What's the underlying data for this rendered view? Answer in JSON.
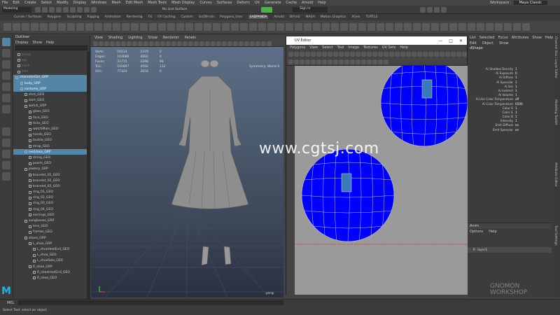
{
  "menubar": [
    "File",
    "Edit",
    "Create",
    "Select",
    "Modify",
    "Display",
    "Windows",
    "Mesh",
    "Edit Mesh",
    "Mesh Tools",
    "Mesh Display",
    "Curves",
    "Surfaces",
    "Deform",
    "UV",
    "Generate",
    "Cache",
    "Arnold",
    "Help"
  ],
  "workspace": {
    "label": "Workspace :",
    "value": "Maya Classic"
  },
  "statusline": {
    "mode": "Modeling",
    "live_surface": "No Live Surface",
    "sign_in": "Sign In"
  },
  "shelf_tabs": [
    "Curves / Surfaces",
    "Polygons",
    "Sculpting",
    "Rigging",
    "Animation",
    "Rendering",
    "FX",
    "FX Caching",
    "Custom",
    "GoZBrush",
    "Polygons_User",
    "SADPANDA",
    "Arnold",
    "Bifrost",
    "MASH",
    "Motion Graphics",
    "XGen",
    "TURTLE"
  ],
  "shelf_active": "SADPANDA",
  "outliner": {
    "title": "Outliner",
    "menu": [
      "Display",
      "Show",
      "Help"
    ],
    "items": [
      {
        "label": "persp",
        "indent": 6,
        "dim": true
      },
      {
        "label": "top",
        "indent": 6,
        "dim": true
      },
      {
        "label": "front",
        "indent": 6,
        "dim": true
      },
      {
        "label": "side",
        "indent": 6,
        "dim": true
      },
      {
        "label": "characterGirl_GRP",
        "indent": 3,
        "sel": true
      },
      {
        "label": "body_GRP",
        "indent": 10,
        "sel": true
      },
      {
        "label": "costume_GRP",
        "indent": 10,
        "sel": true
      },
      {
        "label": "shirt_GEO",
        "indent": 16
      },
      {
        "label": "skirt_GEO",
        "indent": 16
      },
      {
        "label": "watch_GRP",
        "indent": 16
      },
      {
        "label": "glass_GEO",
        "indent": 22
      },
      {
        "label": "face_GEO",
        "indent": 22
      },
      {
        "label": "ticks_GEO",
        "indent": 22
      },
      {
        "label": "watchMain_GEO",
        "indent": 22
      },
      {
        "label": "hands_GEO",
        "indent": 22
      },
      {
        "label": "buckle_GEO",
        "indent": 22
      },
      {
        "label": "strap_GEO",
        "indent": 22
      },
      {
        "label": "necklace_GRP",
        "indent": 16,
        "sel": true
      },
      {
        "label": "string_GEO",
        "indent": 22
      },
      {
        "label": "pearls_GEO",
        "indent": 22
      },
      {
        "label": "jewlery_GRP",
        "indent": 16
      },
      {
        "label": "bracelet_01_GEO",
        "indent": 22
      },
      {
        "label": "bracelet_02_GEO",
        "indent": 22
      },
      {
        "label": "bracelet_03_GEO",
        "indent": 22
      },
      {
        "label": "ring_01_GEO",
        "indent": 22
      },
      {
        "label": "ring_02_GEO",
        "indent": 22
      },
      {
        "label": "ring_03_GEO",
        "indent": 22
      },
      {
        "label": "ring_04_GEO",
        "indent": 22
      },
      {
        "label": "earrings_GEO",
        "indent": 22
      },
      {
        "label": "sunglasses_GRP",
        "indent": 16
      },
      {
        "label": "lens_GEO",
        "indent": 22
      },
      {
        "label": "frames_GEO",
        "indent": 22
      },
      {
        "label": "shoes_GRP",
        "indent": 16
      },
      {
        "label": "L_shoe_GRP",
        "indent": 22
      },
      {
        "label": "L_shoeHeelEnd_GEO",
        "indent": 28
      },
      {
        "label": "L_shoe_GEO",
        "indent": 28
      },
      {
        "label": "L_shoeSole_GEO",
        "indent": 28
      },
      {
        "label": "R_shoe_GRP",
        "indent": 22
      },
      {
        "label": "R_shoeHeelEnd_GEO",
        "indent": 28
      },
      {
        "label": "R_shoe_GEO",
        "indent": 28
      }
    ]
  },
  "viewport": {
    "menu": [
      "View",
      "Shading",
      "Lighting",
      "Show",
      "Renderer",
      "Panels"
    ],
    "hud": [
      {
        "label": "Verts:",
        "a": "50214",
        "b": "2379",
        "c": "0"
      },
      {
        "label": "Edges:",
        "a": "103686",
        "b": "4692",
        "c": "0"
      },
      {
        "label": "Faces:",
        "a": "51715",
        "b": "2298",
        "c": "94"
      },
      {
        "label": "Tris:",
        "a": "102897",
        "b": "4592",
        "c": "112"
      },
      {
        "label": "UVs:",
        "a": "77324",
        "b": "3654",
        "c": "0"
      }
    ],
    "symmetry": "Symmetry: World X",
    "camera": "persp"
  },
  "uv_editor": {
    "title": "UV Editor",
    "menu": [
      "Polygons",
      "View",
      "Select",
      "Tool",
      "Image",
      "Textures",
      "UV Sets",
      "Help"
    ],
    "fill_color": "#0000ff",
    "select_color": "#3a7ab8"
  },
  "attr": {
    "tabs": [
      "List",
      "Selected",
      "Focus",
      "Attributes",
      "Show",
      "Help"
    ],
    "menu": [
      "Edit",
      "Object",
      "Show"
    ],
    "node": "aiSkyDomeLightShape",
    "node_short": "dShape",
    "attrs": [
      {
        "label": "Ai Shadow Density",
        "val": "1"
      },
      {
        "label": "Ai Exposure",
        "val": "0"
      },
      {
        "label": "Ai Diffuse",
        "val": "1"
      },
      {
        "label": "Ai Specular",
        "val": "1"
      },
      {
        "label": "Ai Sss",
        "val": "1"
      },
      {
        "label": "Ai Indirect",
        "val": "1"
      },
      {
        "label": "Ai Volume",
        "val": "1"
      },
      {
        "label": "Ai Use Color Temperature",
        "val": "off"
      },
      {
        "label": "Ai Color Temperature",
        "val": "6500"
      },
      {
        "label": "Color R",
        "val": "1"
      },
      {
        "label": "Color G",
        "val": "1"
      },
      {
        "label": "Color B",
        "val": "1"
      },
      {
        "label": "Intensity",
        "val": "1"
      },
      {
        "label": "Emit Diffuse",
        "val": "on"
      },
      {
        "label": "Emit Specular",
        "val": "on"
      }
    ],
    "layer_menu": [
      "Anim"
    ],
    "layer_sub": [
      "Options",
      "Help"
    ],
    "layer_name": "layer1"
  },
  "vtabs": [
    "Channel Box / Layer Editor",
    "Modeling Toolkit",
    "Attribute Editor",
    "Tool Settings"
  ],
  "cmdline": {
    "label": "MEL"
  },
  "helpline": "Select Tool: select an object",
  "watermark_site": "www.cgtsj.com",
  "watermark_brand": "GNOMON WORKSHOP"
}
